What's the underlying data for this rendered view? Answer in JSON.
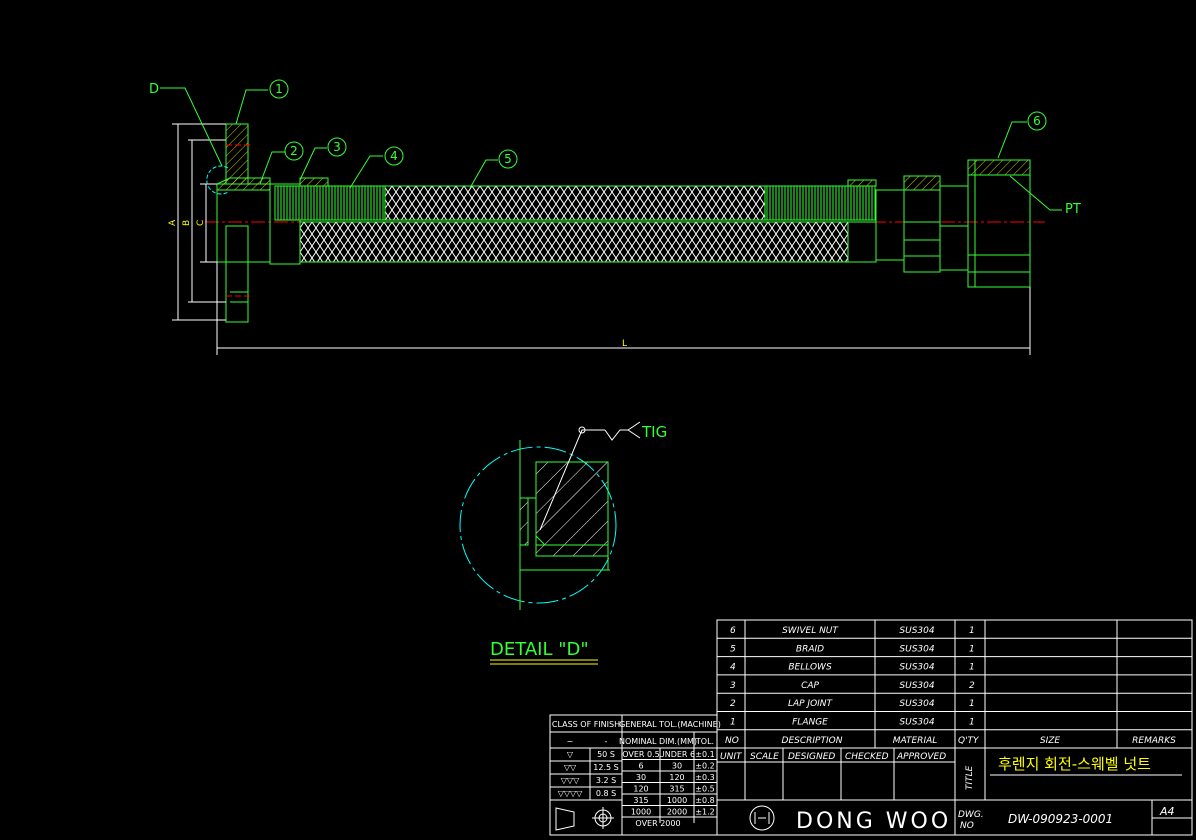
{
  "drawing": {
    "callouts": [
      "1",
      "2",
      "3",
      "4",
      "5",
      "6"
    ],
    "detail_marker": "D",
    "thread_label": "PT",
    "dim_labels": {
      "a": "A",
      "b": "B",
      "c": "C",
      "length": "L"
    },
    "detail_title": "DETAIL \"D\"",
    "weld_label": "TIG"
  },
  "colors": {
    "background": "#000000",
    "green": "#33ff33",
    "yellow": "#ffff00",
    "white": "#ffffff",
    "red": "#ff0000",
    "cyan": "#00ffff",
    "magenta": "#ff00ff"
  },
  "parts_list": {
    "rows": [
      {
        "no": "6",
        "description": "SWIVEL NUT",
        "material": "SUS304",
        "qty": "1"
      },
      {
        "no": "5",
        "description": "BRAID",
        "material": "SUS304",
        "qty": "1"
      },
      {
        "no": "4",
        "description": "BELLOWS",
        "material": "SUS304",
        "qty": "1"
      },
      {
        "no": "3",
        "description": "CAP",
        "material": "SUS304",
        "qty": "2"
      },
      {
        "no": "2",
        "description": "LAP JOINT",
        "material": "SUS304",
        "qty": "1"
      },
      {
        "no": "1",
        "description": "FLANGE",
        "material": "SUS304",
        "qty": "1"
      }
    ],
    "headers": {
      "no": "NO",
      "description": "DESCRIPTION",
      "material": "MATERIAL",
      "qty": "Q'TY",
      "size": "SIZE",
      "remarks": "REMARKS"
    }
  },
  "finish_table": {
    "class_header": "CLASS OF FINISH",
    "tol_header": "GENERAL TOL.(MACHINE)",
    "nominal_header": "NOMINAL DIM.(MM)",
    "tol_col": "TOL.",
    "finish_rows": [
      {
        "symbol": "~",
        "value": "-"
      },
      {
        "symbol": "▽",
        "value": "50 S"
      },
      {
        "symbol": "▽▽",
        "value": "12.5 S"
      },
      {
        "symbol": "▽▽▽",
        "value": "3.2 S"
      },
      {
        "symbol": "▽▽▽▽",
        "value": "0.8 S"
      }
    ],
    "tol_rows": [
      {
        "over": "OVER 0.5",
        "under": "UNDER 6",
        "tol": "±0.1"
      },
      {
        "over": "6",
        "under": "30",
        "tol": "±0.2"
      },
      {
        "over": "30",
        "under": "120",
        "tol": "±0.3"
      },
      {
        "over": "120",
        "under": "315",
        "tol": "±0.5"
      },
      {
        "over": "315",
        "under": "1000",
        "tol": "±0.8"
      },
      {
        "over": "1000",
        "under": "2000",
        "tol": "±1.2"
      },
      {
        "over": "OVER 2000",
        "under": "",
        "tol": ""
      }
    ]
  },
  "title_block": {
    "unit": "UNIT",
    "scale": "SCALE",
    "designed": "DESIGNED",
    "checked": "CHECKED",
    "approved": "APPROVED",
    "title_label": "TITLE",
    "title": "후렌지 회전-스웨벨 넛트",
    "company": "DONG WOO",
    "dwg_label_1": "DWG.",
    "dwg_label_2": "NO",
    "dwg_no": "DW-090923-0001",
    "sheet": "A4"
  }
}
